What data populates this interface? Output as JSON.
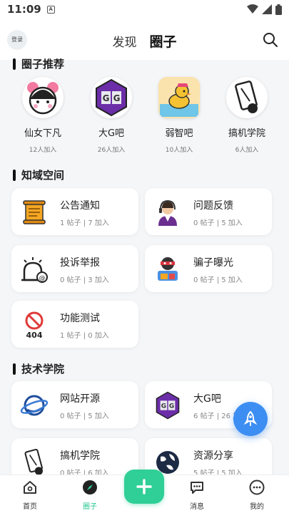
{
  "status_bar": {
    "time": "11:09",
    "notif_glyph": "A"
  },
  "header": {
    "login_label": "登录",
    "tab_discover": "发现",
    "tab_circle": "圈子"
  },
  "sections": {
    "recommended": "圈子推荐",
    "knowledge": "知域空间",
    "tech": "技术学院"
  },
  "recommended": [
    {
      "name": "仙女下凡",
      "count": "12人加入",
      "icon": "girl-avatar-icon"
    },
    {
      "name": "大G吧",
      "count": "26人加入",
      "icon": "gg-logo-icon"
    },
    {
      "name": "弱智吧",
      "count": "10人加入",
      "icon": "duck-icon"
    },
    {
      "name": "搞机学院",
      "count": "6人加入",
      "icon": "phone-icon"
    }
  ],
  "knowledge_cards": [
    {
      "title": "公告通知",
      "meta": "1 帖子 | 7 加入",
      "icon": "scroll-icon"
    },
    {
      "title": "问题反馈",
      "meta": "0 帖子 | 5 加入",
      "icon": "support-agent-icon"
    },
    {
      "title": "投诉举报",
      "meta": "0 帖子 | 3 加入",
      "icon": "alarm-icon"
    },
    {
      "title": "骗子曝光",
      "meta": "0 帖子 | 5 加入",
      "icon": "thief-icon"
    },
    {
      "title": "功能测试",
      "meta": "1 帖子 | 0 加入",
      "icon": "404-icon"
    }
  ],
  "tech_cards": [
    {
      "title": "网站开源",
      "meta": "0 帖子 | 5 加入",
      "icon": "planet-icon"
    },
    {
      "title": "大G吧",
      "meta": "6 帖子 | 26 加入",
      "icon": "gg-logo-icon"
    },
    {
      "title": "搞机学院",
      "meta": "0 帖子 | 6 加入",
      "icon": "phone-icon"
    },
    {
      "title": "资源分享",
      "meta": "5 帖子 | 5 加入",
      "icon": "globe-icon"
    }
  ],
  "bottom_nav": {
    "home": "首页",
    "circle": "圈子",
    "messages": "消息",
    "mine": "我的"
  },
  "colors": {
    "accent": "#2fcf97",
    "fab": "#3d8ef2"
  }
}
